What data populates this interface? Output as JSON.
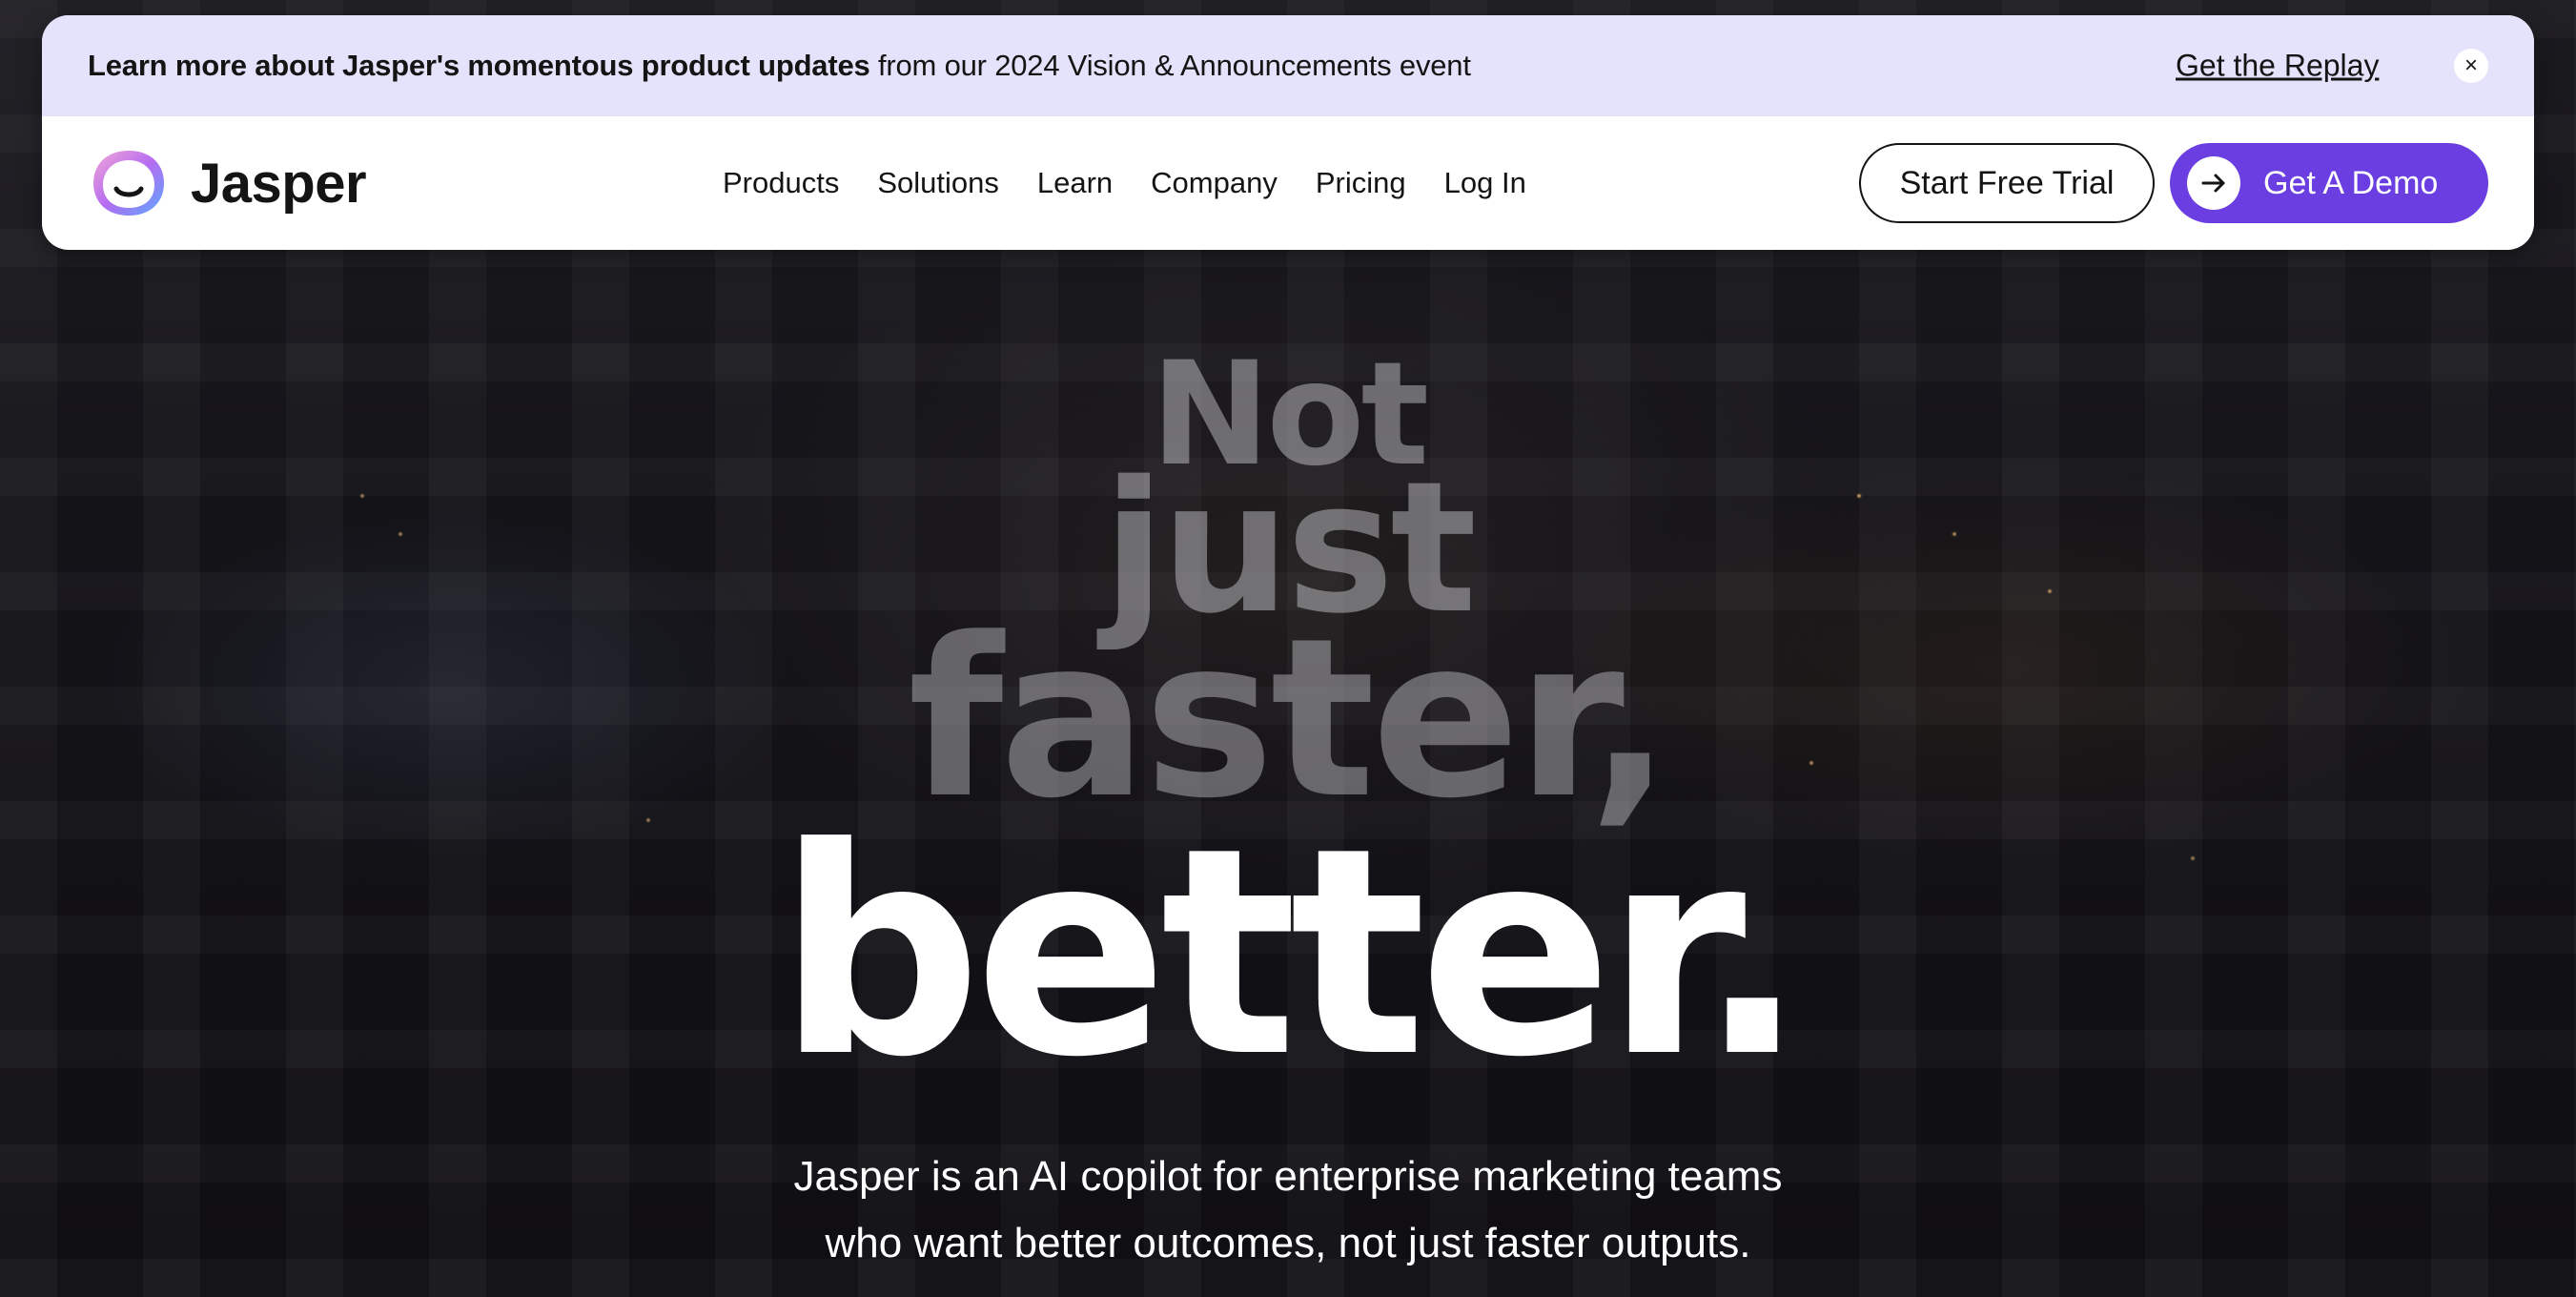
{
  "announcement": {
    "bold_text": "Learn more about Jasper's momentous product updates",
    "text": " from our 2024 Vision & Announcements event",
    "link_label": "Get the Replay",
    "close_label": "×"
  },
  "nav": {
    "brand": "Jasper",
    "links": [
      "Products",
      "Solutions",
      "Learn",
      "Company",
      "Pricing",
      "Log In"
    ],
    "trial_label": "Start Free Trial",
    "demo_label": "Get A Demo"
  },
  "hero": {
    "lines": [
      "Not",
      "just",
      "faster,",
      "better."
    ],
    "subtitle_lines": [
      "Jasper is an AI copilot for enterprise marketing teams",
      "who want better outcomes, not just faster outputs."
    ]
  },
  "colors": {
    "announce_bg": "#e4e3fb",
    "accent": "#6a3ee0"
  }
}
